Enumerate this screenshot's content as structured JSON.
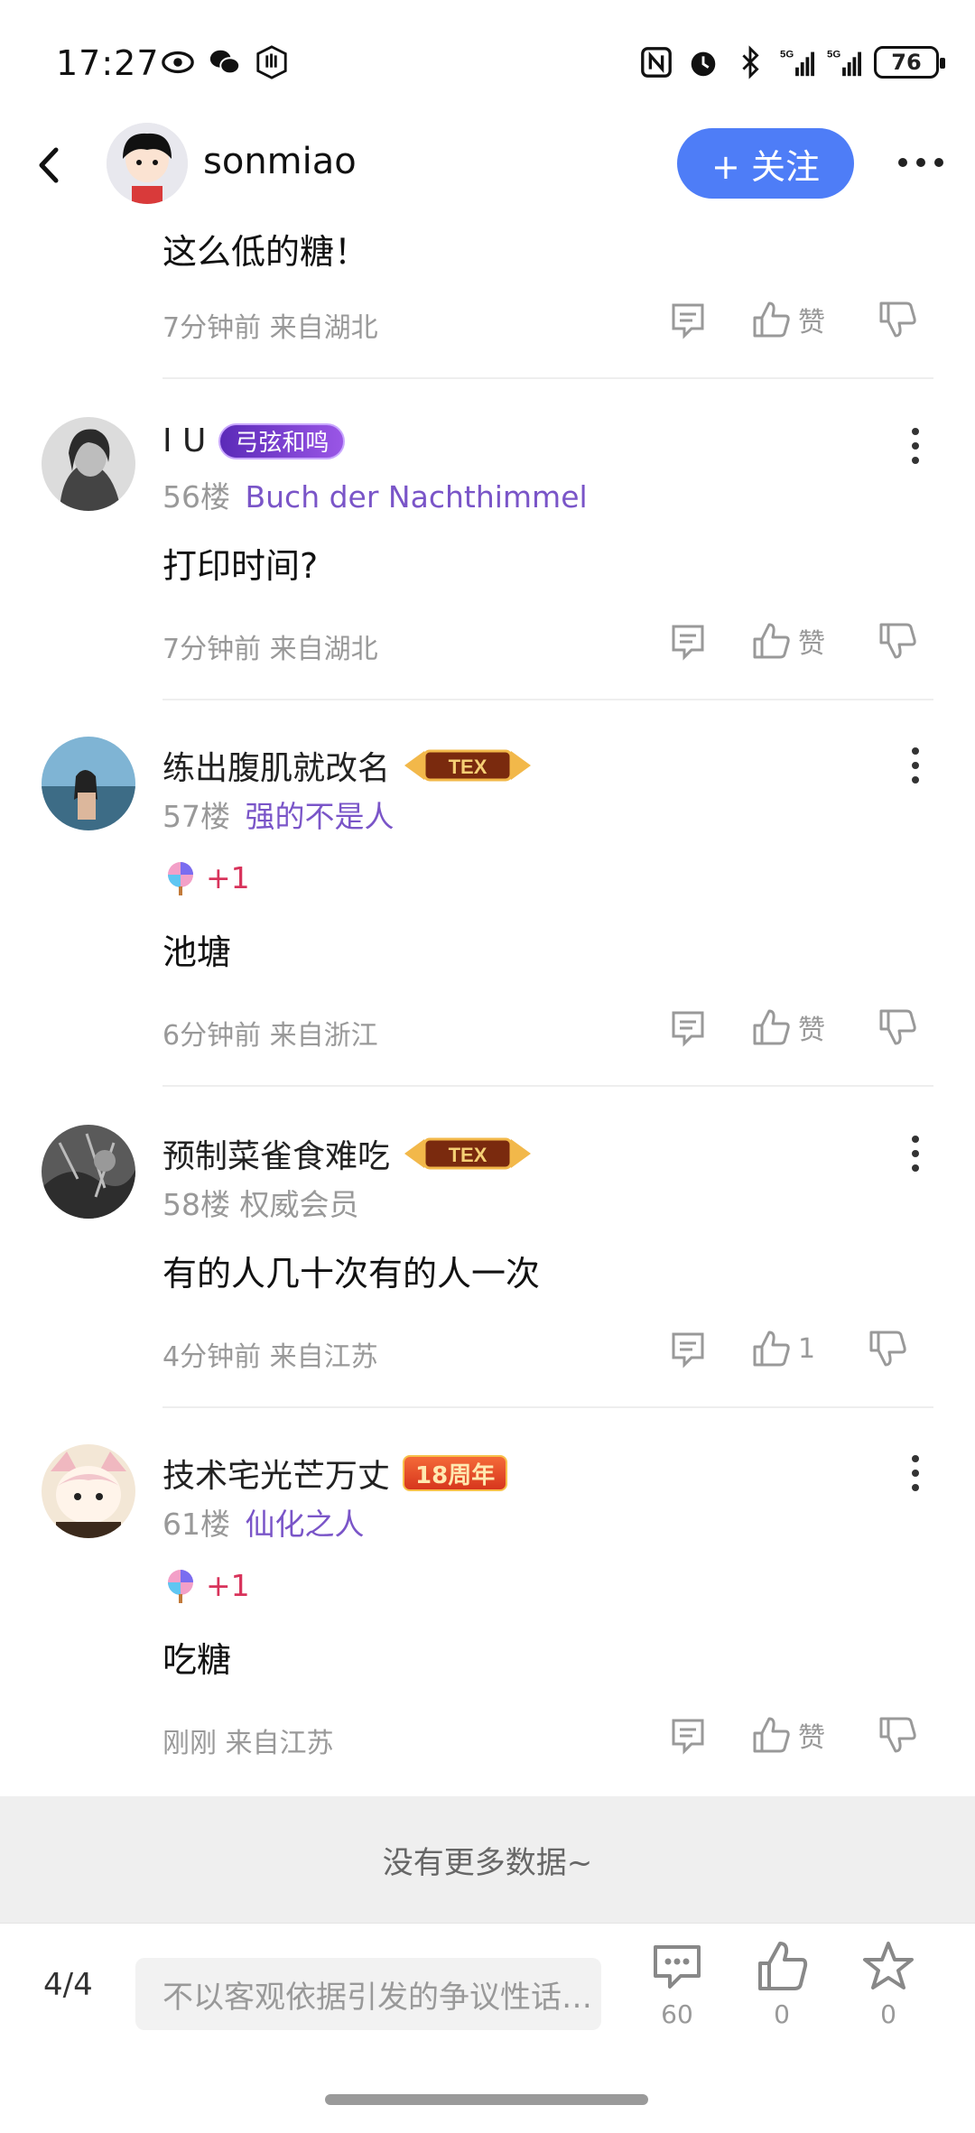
{
  "status_bar": {
    "time": "17:27",
    "battery": "76"
  },
  "header": {
    "username": "sonmiao",
    "follow_label": "+ 关注"
  },
  "posts": [
    {
      "content": "这么低的糖！",
      "time": "7分钟前",
      "location": "来自湖北",
      "likes": "赞"
    },
    {
      "username": "I U",
      "badge": "弓弦和鸣",
      "floor": "56楼",
      "title": "Buch der Nachthimmel",
      "content": "打印时间?",
      "time": "7分钟前",
      "location": "来自湖北",
      "likes": "赞"
    },
    {
      "username": "练出腹肌就改名",
      "badge": "TEX",
      "floor": "57楼",
      "title": "强的不是人",
      "gift": "+1",
      "content": "池塘",
      "time": "6分钟前",
      "location": "来自浙江",
      "likes": "赞"
    },
    {
      "username": "预制菜雀食难吃",
      "badge": "TEX",
      "floor": "58楼",
      "title": "权威会员",
      "content": "有的人几十次有的人一次",
      "time": "4分钟前",
      "location": "来自江苏",
      "likes": "1"
    },
    {
      "username": "技术宅光芒万丈",
      "badge": "18周年",
      "floor": "61楼",
      "title": "仙化之人",
      "gift": "+1",
      "content": "吃糖",
      "time": "刚刚",
      "location": "来自江苏",
      "likes": "赞"
    }
  ],
  "no_more": "没有更多数据~",
  "bottom_bar": {
    "pager": "4/4",
    "input_placeholder": "不以客观依据引发的争议性话…",
    "comments": "60",
    "likes": "0",
    "favorites": "0"
  }
}
